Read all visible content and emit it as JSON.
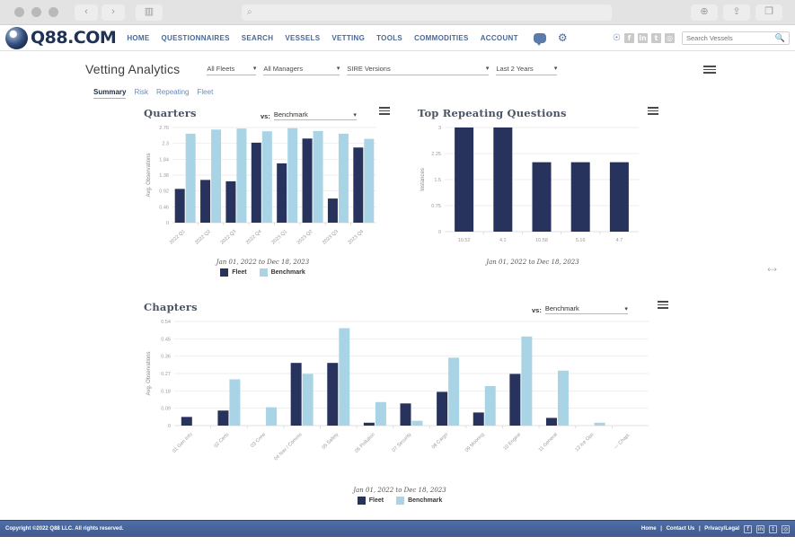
{
  "browser": {
    "back_icon": "‹",
    "forward_icon": "›",
    "sidebar_icon": "▥",
    "address_placeholder": "",
    "search_icon": "⌕",
    "download_icon": "⊕",
    "share_icon": "⇪",
    "tabs_icon": "❐"
  },
  "header": {
    "logo_text": "Q88.COM",
    "nav": [
      {
        "label": "HOME"
      },
      {
        "label": "QUESTIONNAIRES"
      },
      {
        "label": "SEARCH"
      },
      {
        "label": "VESSELS"
      },
      {
        "label": "VETTING"
      },
      {
        "label": "TOOLS"
      },
      {
        "label": "COMMODITIES"
      },
      {
        "label": "ACCOUNT"
      }
    ],
    "chat_icon": "chat-icon",
    "gear_icon": "⚙",
    "bell_icon": "🔔",
    "social": [
      {
        "name": "facebook",
        "glyph": "f"
      },
      {
        "name": "linkedin",
        "glyph": "in"
      },
      {
        "name": "twitter",
        "glyph": "t"
      },
      {
        "name": "instagram",
        "glyph": "◎"
      }
    ],
    "vessel_search_placeholder": "Search Vessels",
    "vessel_search_value": "",
    "magnifier": "🔍"
  },
  "toolbar": {
    "page_title": "Vetting Analytics",
    "filters": [
      {
        "name": "fleets",
        "value": "All Fleets"
      },
      {
        "name": "managers",
        "value": "All Managers"
      },
      {
        "name": "sire",
        "value": "SIRE Versions"
      },
      {
        "name": "years",
        "value": "Last 2 Years"
      }
    ],
    "caret": "▾"
  },
  "tabs": [
    {
      "label": "Summary",
      "active": true
    },
    {
      "label": "Risk",
      "active": false
    },
    {
      "label": "Repeating",
      "active": false
    },
    {
      "label": "Fleet",
      "active": false
    }
  ],
  "colors": {
    "fleet": "#27335c",
    "benchmark": "#a8d4e6",
    "accent": "#4a6895",
    "footer": "#4f6ea8"
  },
  "cards": {
    "quarters": {
      "title": "Quarters",
      "vs_label": "vs:",
      "vs_value": "Benchmark",
      "menu_icon": "hamburger-icon"
    },
    "repeating": {
      "title": "Top Repeating Questions",
      "menu_icon": "hamburger-icon"
    },
    "chapters": {
      "title": "Chapters",
      "vs_label": "vs:",
      "vs_value": "Benchmark",
      "menu_icon": "hamburger-icon"
    }
  },
  "chart_data": [
    {
      "id": "quarters",
      "type": "bar",
      "title": "Quarters",
      "xlabel": "",
      "ylabel": "Avg. Observations",
      "categories": [
        "2022 Q1",
        "2022 Q2",
        "2022 Q3",
        "2022 Q4",
        "2023 Q1",
        "2023 Q2",
        "2023 Q3",
        "2023 Q4"
      ],
      "yticks": [
        0,
        0.46,
        0.92,
        1.38,
        1.84,
        2.3,
        2.76
      ],
      "ytick_labels": [
        "0",
        "0.46",
        "0.92",
        "1.38",
        "1.84",
        "2.3",
        "2.76"
      ],
      "ylim": [
        0,
        2.76
      ],
      "grid": true,
      "legend_position": "bottom",
      "caption": "Jan 01, 2022 to Dec 18, 2023",
      "series": [
        {
          "name": "Fleet",
          "color": "#27335c",
          "values": [
            0.98,
            1.24,
            1.2,
            2.32,
            1.72,
            2.44,
            0.7,
            2.18
          ]
        },
        {
          "name": "Benchmark",
          "color": "#a8d4e6",
          "values": [
            2.58,
            2.7,
            2.73,
            2.65,
            2.74,
            2.66,
            2.58,
            2.43
          ]
        }
      ]
    },
    {
      "id": "repeating",
      "type": "bar",
      "title": "Top Repeating Questions",
      "xlabel": "",
      "ylabel": "Instances",
      "categories": [
        "10.52",
        "4.1",
        "10.58",
        "5.16",
        "4.7"
      ],
      "yticks": [
        0,
        0.75,
        1.5,
        2.25,
        3
      ],
      "ytick_labels": [
        "0",
        "0.75",
        "1.5",
        "2.25",
        "3"
      ],
      "ylim": [
        0,
        3
      ],
      "grid": true,
      "legend_position": "none",
      "caption": "Jan 01, 2022 to Dec 18, 2023",
      "series": [
        {
          "name": "Instances",
          "color": "#27335c",
          "values": [
            3,
            3,
            2,
            2,
            2
          ]
        }
      ]
    },
    {
      "id": "chapters",
      "type": "bar",
      "title": "Chapters",
      "xlabel": "",
      "ylabel": "Avg. Observations",
      "categories": [
        "01 Gen Info",
        "02 Certs",
        "03 Crew",
        "04 Nav / Comms",
        "05 Safety",
        "06 Pollution",
        "07 Security",
        "08 Cargo",
        "09 Mooring",
        "10 Engine",
        "11 General",
        "12 Ice Ops",
        "— Chapt."
      ],
      "yticks": [
        0,
        0.09,
        0.18,
        0.27,
        0.36,
        0.45,
        0.54
      ],
      "ytick_labels": [
        "0",
        "0.09",
        "0.18",
        "0.27",
        "0.36",
        "0.45",
        "0.54"
      ],
      "ylim": [
        0,
        0.54
      ],
      "grid": true,
      "legend_position": "bottom",
      "caption": "Jan 01, 2022 to Dec 18, 2023",
      "series": [
        {
          "name": "Fleet",
          "color": "#27335c",
          "values": [
            0.045,
            0.078,
            0.0,
            0.325,
            0.325,
            0.015,
            0.115,
            0.175,
            0.068,
            0.268,
            0.04,
            0.0,
            0.0
          ]
        },
        {
          "name": "Benchmark",
          "color": "#a8d4e6",
          "values": [
            0.0,
            0.24,
            0.095,
            0.268,
            0.505,
            0.122,
            0.025,
            0.352,
            0.205,
            0.462,
            0.285,
            0.015,
            0.0
          ]
        }
      ]
    }
  ],
  "footer": {
    "copyright": "Copyright ©2022 Q88 LLC. All rights reserved.",
    "links": [
      "Home",
      "Contact Us",
      "Privacy/Legal"
    ],
    "separator": "|",
    "social": [
      {
        "name": "facebook",
        "glyph": "f"
      },
      {
        "name": "linkedin",
        "glyph": "in"
      },
      {
        "name": "twitter",
        "glyph": "t"
      },
      {
        "name": "instagram",
        "glyph": "◎"
      }
    ]
  }
}
